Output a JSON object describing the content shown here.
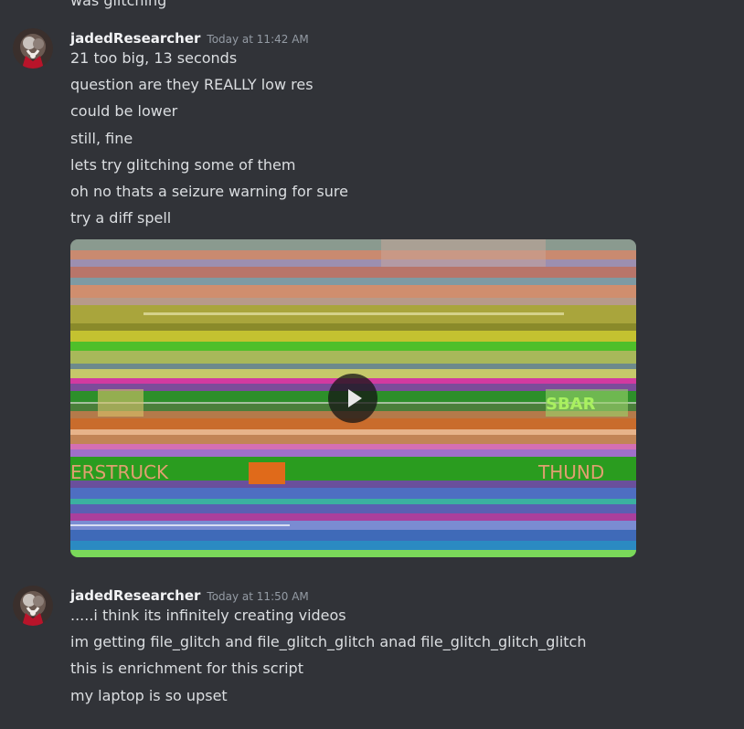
{
  "previous_message": {
    "partial_text": "was glitching"
  },
  "messages": [
    {
      "username": "jadedResearcher",
      "timestamp": "Today at 11:42 AM",
      "lines": [
        "21 too big, 13 seconds",
        "question are they REALLY low res",
        "could be lower",
        "still, fine",
        "lets try glitching some of them",
        "oh no thats a seizure warning for sure",
        "try a diff spell"
      ],
      "attachment": {
        "type": "video",
        "icon": "play-icon",
        "overlay_text_left": "ERSTRUCK",
        "overlay_text_right": "THUND",
        "overlay_text_top_right": "SBAR"
      }
    },
    {
      "username": "jadedResearcher",
      "timestamp": "Today at 11:50 AM",
      "lines": [
        ".....i think its infinitely creating videos",
        "im getting file_glitch and file_glitch_glitch anad file_glitch_glitch_glitch",
        "this is enrichment for this script",
        "my laptop is so upset"
      ]
    }
  ],
  "colors": {
    "background": "#313338",
    "username": "#f2f3f5",
    "timestamp": "#949ba4",
    "message_text": "#dbdee1"
  }
}
